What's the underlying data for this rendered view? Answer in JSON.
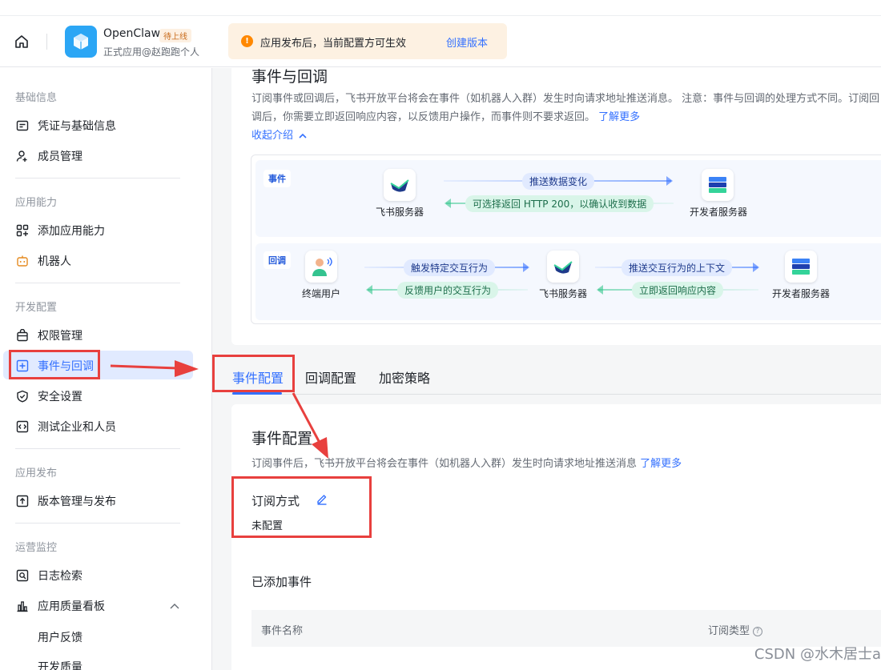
{
  "header": {
    "app_name": "OpenClaw",
    "app_badge": "待上线",
    "app_subtitle": "正式应用@赵跑跑个人",
    "notice_text": "应用发布后，当前配置方可生效",
    "notice_link": "创建版本"
  },
  "sidebar": {
    "sections": [
      {
        "label": "基础信息",
        "items": [
          {
            "label": "凭证与基础信息",
            "icon": "credential-icon"
          },
          {
            "label": "成员管理",
            "icon": "member-icon"
          }
        ]
      },
      {
        "label": "应用能力",
        "items": [
          {
            "label": "添加应用能力",
            "icon": "grid-add-icon"
          },
          {
            "label": "机器人",
            "icon": "robot-icon"
          }
        ]
      },
      {
        "label": "开发配置",
        "items": [
          {
            "label": "权限管理",
            "icon": "permission-icon"
          },
          {
            "label": "事件与回调",
            "icon": "event-icon",
            "active": true
          },
          {
            "label": "安全设置",
            "icon": "shield-icon"
          },
          {
            "label": "测试企业和人员",
            "icon": "code-icon"
          }
        ]
      },
      {
        "label": "应用发布",
        "items": [
          {
            "label": "版本管理与发布",
            "icon": "upload-icon"
          }
        ]
      },
      {
        "label": "运营监控",
        "items": [
          {
            "label": "日志检索",
            "icon": "log-search-icon"
          },
          {
            "label": "应用质量看板",
            "icon": "bar-chart-icon"
          }
        ],
        "subitems": [
          "用户反馈",
          "开发质量"
        ]
      }
    ]
  },
  "intro": {
    "title": "事件与回调",
    "desc": "订阅事件或回调后，飞书开放平台将会在事件（如机器人入群）发生时向请求地址推送消息。 注意：事件与回调的处理方式不同。订阅回调后，你需要立即返回响应内容，以反馈用户操作，而事件则不要求返回。",
    "learn_more": "了解更多",
    "collapse": "收起介绍"
  },
  "diagram": {
    "event": {
      "tag": "事件",
      "left_node": "飞书服务器",
      "right_node": "开发者服务器",
      "forward": "推送数据变化",
      "back": "可选择返回 HTTP 200，以确认收到数据"
    },
    "callback": {
      "tag": "回调",
      "node1": "终端用户",
      "node2": "飞书服务器",
      "node3": "开发者服务器",
      "forward1": "触发特定交互行为",
      "back1": "反馈用户的交互行为",
      "forward2": "推送交互行为的上下文",
      "back2": "立即返回响应内容"
    }
  },
  "tabs": [
    "事件配置",
    "回调配置",
    "加密策略"
  ],
  "event_config": {
    "title": "事件配置",
    "desc": "订阅事件后，飞书开放平台将会在事件（如机器人入群）发生时向请求地址推送消息",
    "learn_more": "了解更多",
    "subscription_label": "订阅方式",
    "subscription_value": "未配置",
    "added_title": "已添加事件",
    "columns": [
      "事件名称",
      "订阅类型"
    ]
  },
  "watermark": "CSDN @水木居士a",
  "colors": {
    "accent": "#3370ff",
    "annotation": "#e8403e",
    "warning": "#ff8800"
  }
}
